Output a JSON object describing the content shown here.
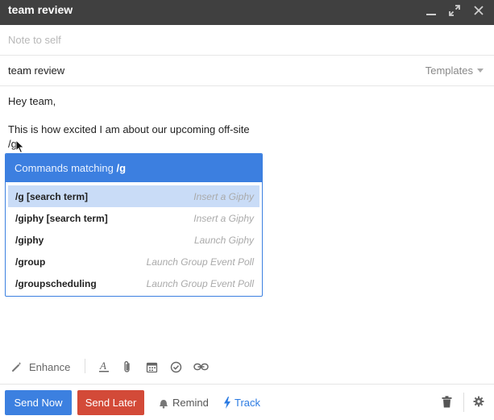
{
  "window": {
    "title": "team review",
    "controls": [
      "minimize-icon",
      "expand-icon",
      "close-icon"
    ]
  },
  "to_field": {
    "placeholder": "Note to self"
  },
  "subject": {
    "value": "team review",
    "templates_label": "Templates"
  },
  "body": {
    "line1": "Hey team,",
    "line2": "This is how excited I am about our upcoming off-site",
    "line3": "/g"
  },
  "command_popup": {
    "header_prefix": "Commands matching",
    "query": "/g",
    "items": [
      {
        "name": "/g [search term]",
        "desc": "Insert a Giphy",
        "selected": true
      },
      {
        "name": "/giphy [search term]",
        "desc": "Insert a Giphy",
        "selected": false
      },
      {
        "name": "/giphy",
        "desc": "Launch Giphy",
        "selected": false
      },
      {
        "name": "/group",
        "desc": "Launch Group Event Poll",
        "selected": false
      },
      {
        "name": "/groupscheduling",
        "desc": "Launch Group Event Poll",
        "selected": false
      }
    ]
  },
  "toolbar": {
    "enhance_label": "Enhance",
    "icons": [
      "magic-wand-icon",
      "text-format-icon",
      "paperclip-icon",
      "calendar-icon",
      "check-circle-icon",
      "link-icon"
    ]
  },
  "actions": {
    "send_now": "Send Now",
    "send_later": "Send Later",
    "remind": "Remind",
    "track": "Track"
  },
  "colors": {
    "title_bar": "#404040",
    "primary_blue": "#3c80e0",
    "send_later_red": "#d34a38",
    "selected_row": "#c9dcf7",
    "track_blue": "#2a7ae2"
  }
}
